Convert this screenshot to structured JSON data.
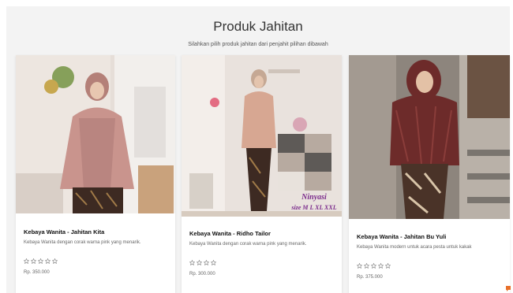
{
  "header": {
    "title": "Produk Jahitan",
    "subtitle": "Silahkan pilih produk jahitan dari penjahit pilihan dibawah"
  },
  "products": [
    {
      "name": "Kebaya Wanita - Jahitan Kita",
      "description": "Kebaya Wanita dengan corak warna pink yang menarik.",
      "price": "Rp. 350.000",
      "rating": 5,
      "photo_label": ""
    },
    {
      "name": "Kebaya Wanita - Ridho Tailor",
      "description": "Kebaya Wanita dengan corak warna pink yang menarik.",
      "price": "Rp. 300.000",
      "rating": 4,
      "photo_label": "Ninyasi size M L XL XXL"
    },
    {
      "name": "Kebaya Wanita - Jahitan Bu Yuli",
      "description": "Kebaya Wanita modern untuk acara pesta untuk kakak",
      "price": "Rp. 375.000",
      "rating": 5,
      "photo_label": ""
    }
  ],
  "colors": {
    "section_bg": "#f3f3f3",
    "card_bg": "#ffffff",
    "kebaya_pink": "#c9948d",
    "kebaya_peach": "#d7a792",
    "kebaya_maroon": "#6d2b2a",
    "batik_brown": "#3d2a22",
    "star_outline": "#888888",
    "chat_icon": "#e8702a"
  },
  "icons": {
    "rating": "star-outline-icon",
    "chat": "chat-bubble-icon"
  }
}
